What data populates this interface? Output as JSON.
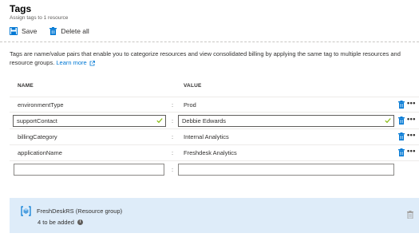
{
  "header": {
    "title": "Tags",
    "subtitle": "Assign tags to 1 resource"
  },
  "toolbar": {
    "save_label": "Save",
    "delete_all_label": "Delete all"
  },
  "description": {
    "text": "Tags are name/value pairs that enable you to categorize resources and view consolidated billing by applying the same tag to multiple resources and resource groups.",
    "link_text": "Learn more"
  },
  "table": {
    "name_header": "NAME",
    "value_header": "VALUE",
    "separator": ":",
    "rows": [
      {
        "name": "environmentType",
        "value": "Prod"
      },
      {
        "name": "supportContact",
        "value": "Debbie Edwards"
      },
      {
        "name": "billingCategory",
        "value": "Internal Analytics"
      },
      {
        "name": "applicationName",
        "value": "Freshdesk Analytics"
      }
    ],
    "new_row": {
      "name": "",
      "value": ""
    }
  },
  "resource_group": {
    "name": "FreshDeskRS",
    "type_label": "(Resource group)",
    "count_text": "4 to be added"
  },
  "colors": {
    "accent": "#0078d4",
    "edit_check": "#8cbd18",
    "panel_bg": "#deecf9",
    "delete_icon": "#0078d4"
  }
}
